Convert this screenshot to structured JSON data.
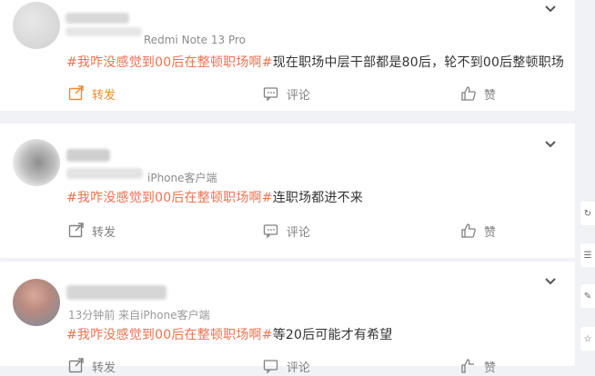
{
  "posts": [
    {
      "source": "Redmi Note 13 Pro",
      "topic": "#我咋没感觉到00后在整顿职场啊#",
      "text": "现在职场中层干部都是80后，轮不到00后整顿职场",
      "actions": {
        "repost": "转发",
        "comment": "评论",
        "like": "赞"
      }
    },
    {
      "source": "iPhone客户端",
      "topic": "#我咋没感觉到00后在整顿职场啊#",
      "text": "连职场都进不来",
      "actions": {
        "repost": "转发",
        "comment": "评论",
        "like": "赞"
      }
    },
    {
      "source": "13分钟前 来自iPhone客户端",
      "topic": "#我咋没感觉到00后在整顿职场啊#",
      "text": "等20后可能才有希望",
      "actions": {
        "repost": "转发",
        "comment": "评论",
        "like": "赞"
      }
    }
  ],
  "colors": {
    "topic": "#eb7350",
    "active_action": "#f08a2c",
    "background": "#f1f2f5"
  },
  "icons": [
    "repost-icon",
    "comment-icon",
    "like-icon",
    "chevron-down-icon"
  ]
}
